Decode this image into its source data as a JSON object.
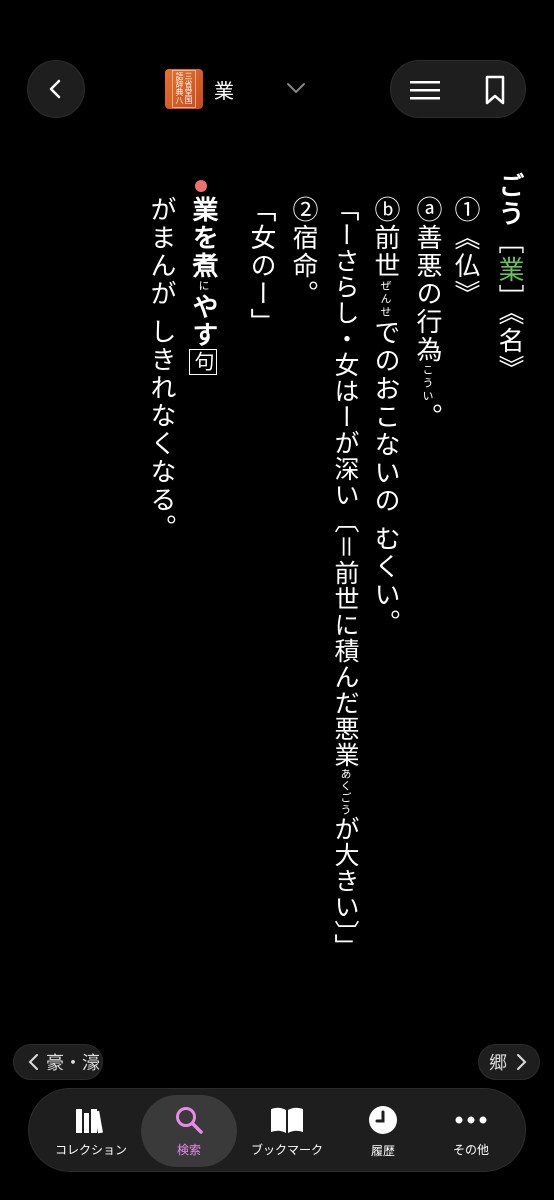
{
  "header": {
    "dict_icon_text": "三省堂国語辞典八",
    "headword": "業"
  },
  "entry": {
    "reading": "ごう",
    "kanji_open": "［",
    "kanji": "業",
    "kanji_close": "］",
    "pos": "《名》",
    "col1": "①《仏》",
    "col2a": "ⓐ善悪の行為",
    "col2a_ruby": "こうい",
    "col2a_end": "。",
    "col3a": "ⓑ前世",
    "col3a_ruby": "ぜんせ",
    "col3b": "でのおこないの むくい。",
    "col4a": "「ーさらし・女はーが深い〔＝前世に積んだ悪業",
    "col4a_ruby": "あくごう",
    "col4b": "が大きい〕」",
    "col5": "②宿命。",
    "col6": "「女のー」",
    "phrase_a": "業を煮",
    "phrase_ruby": "に",
    "phrase_b": "やす",
    "phrase_tag": "句",
    "phrase_def": "がまんが しきれなくなる。"
  },
  "nav": {
    "prev_label": "豪・濠",
    "next_label": "郷"
  },
  "tabs": [
    {
      "label": "コレクション"
    },
    {
      "label": "検索"
    },
    {
      "label": "ブックマーク"
    },
    {
      "label": "履歴"
    },
    {
      "label": "その他"
    }
  ],
  "colors": {
    "accent": "#e98ae9",
    "bullet": "#f07070",
    "kanji": "#6bc05a"
  }
}
